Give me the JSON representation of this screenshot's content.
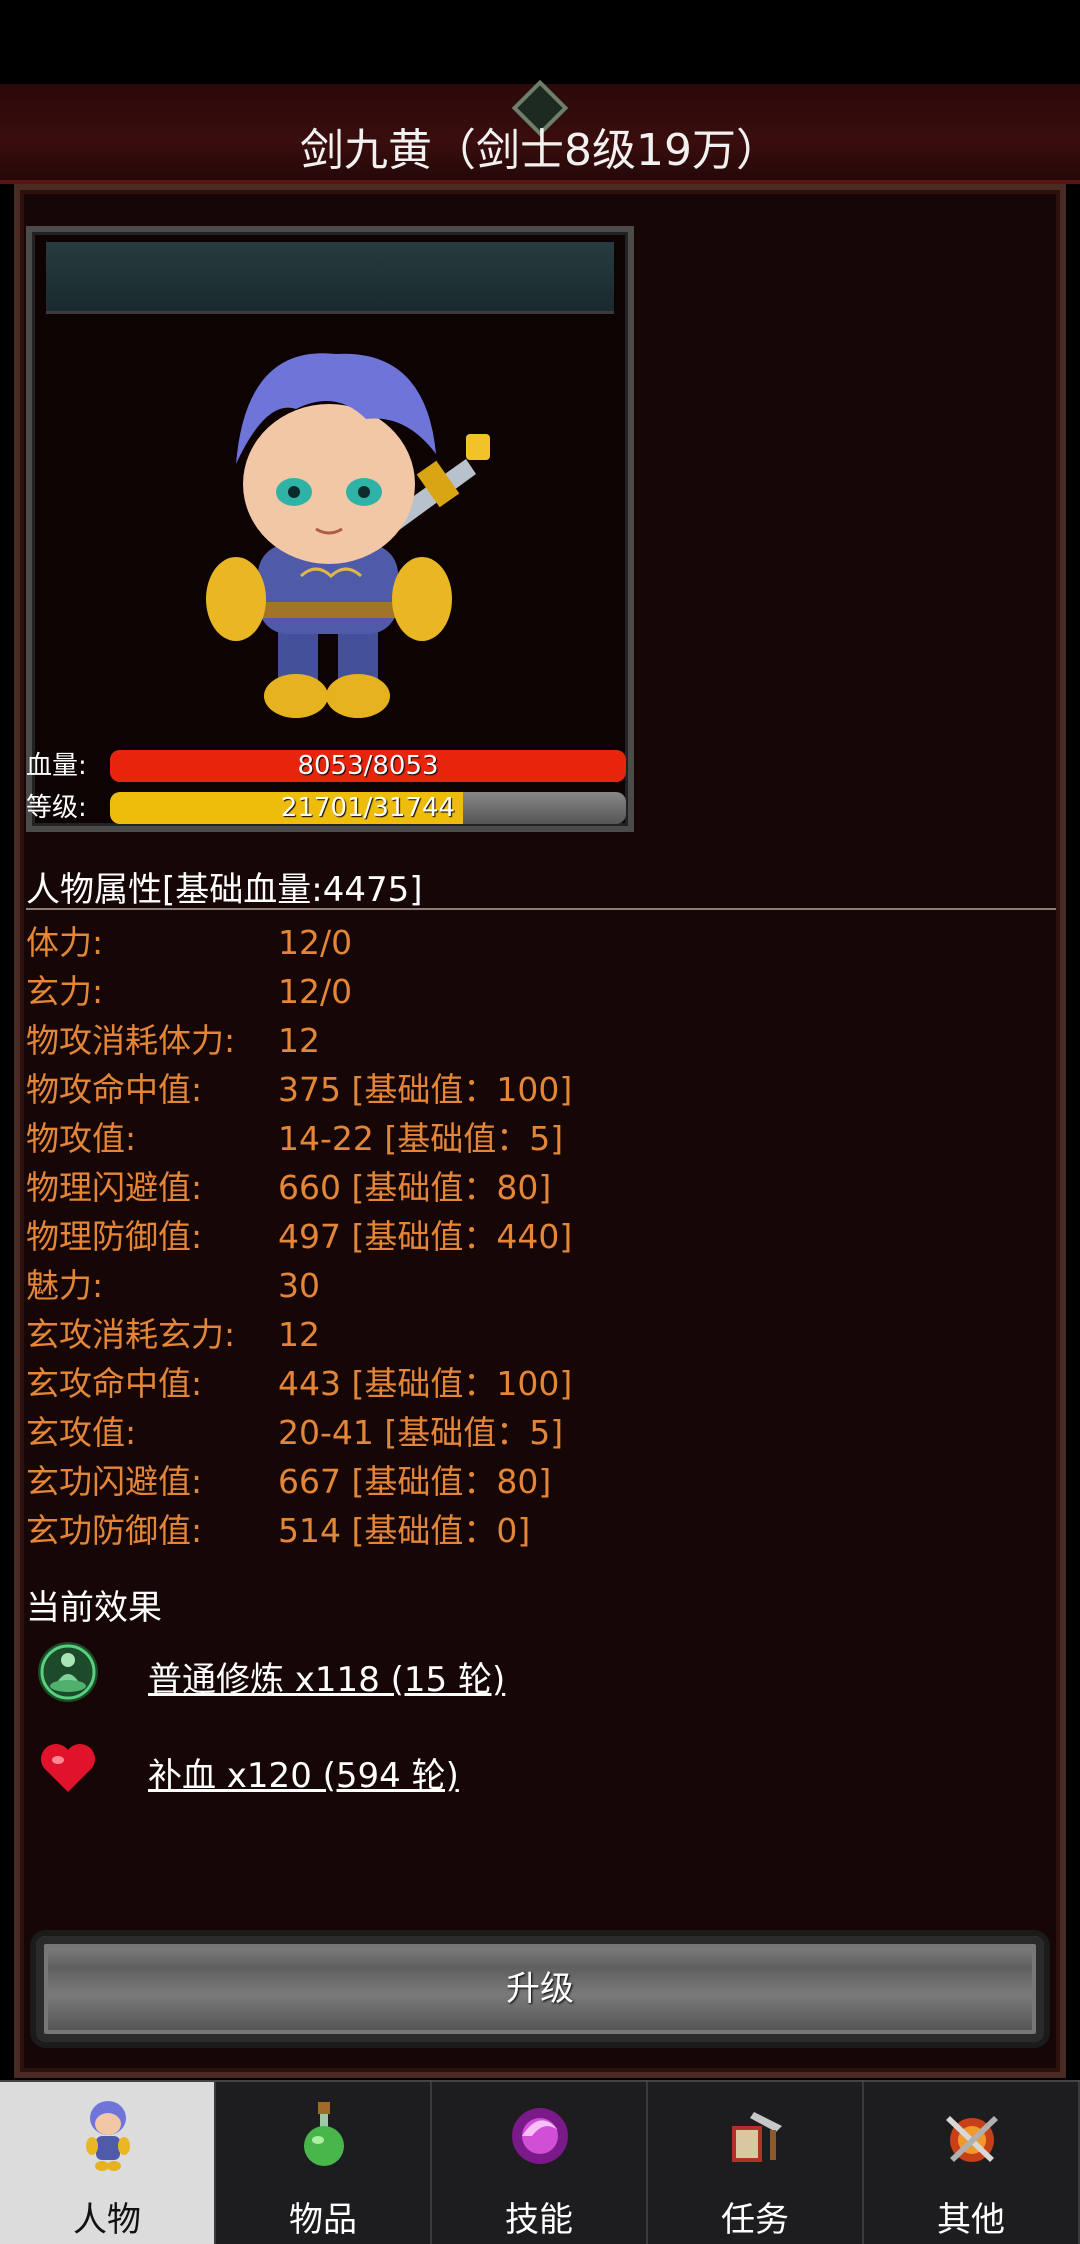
{
  "header": {
    "title": "剑九黄（剑士8级19万）"
  },
  "character": {
    "hp_label": "血量:",
    "hp_text": "8053/8053",
    "hp_fraction": 1.0,
    "level_label": "等级:",
    "level_text": "21701/31744",
    "level_fraction": 0.684
  },
  "attributes": {
    "header": "人物属性[基础血量:4475]",
    "rows": [
      {
        "name": "体力:",
        "value": "12/0"
      },
      {
        "name": "玄力:",
        "value": "12/0"
      },
      {
        "name": "物攻消耗体力:",
        "value": "12"
      },
      {
        "name": "物攻命中值:",
        "value": "375 [基础值：100]"
      },
      {
        "name": "物攻值:",
        "value": "14-22 [基础值：5]"
      },
      {
        "name": "物理闪避值:",
        "value": "660 [基础值：80]"
      },
      {
        "name": "物理防御值:",
        "value": "497 [基础值：440]"
      },
      {
        "name": "魅力:",
        "value": "30"
      },
      {
        "name": "玄攻消耗玄力:",
        "value": "12"
      },
      {
        "name": "玄攻命中值:",
        "value": "443 [基础值：100]"
      },
      {
        "name": "玄攻值:",
        "value": "20-41 [基础值：5]"
      },
      {
        "name": "玄功闪避值:",
        "value": "667 [基础值：80]"
      },
      {
        "name": "玄功防御值:",
        "value": "514 [基础值：0]"
      }
    ]
  },
  "effects": {
    "header": "当前效果",
    "items": [
      {
        "icon": "meditation-icon",
        "text": "普通修炼 x118 (15 轮)"
      },
      {
        "icon": "heart-icon",
        "text": "补血 x120 (594 轮)"
      }
    ]
  },
  "upgrade": {
    "label": "升级"
  },
  "tabs": [
    {
      "label": "人物",
      "icon": "character-icon",
      "active": true
    },
    {
      "label": "物品",
      "icon": "potion-icon",
      "active": false
    },
    {
      "label": "技能",
      "icon": "skill-orb-icon",
      "active": false
    },
    {
      "label": "任务",
      "icon": "quest-icon",
      "active": false
    },
    {
      "label": "其他",
      "icon": "other-icon",
      "active": false
    }
  ],
  "colors": {
    "hp_bar": "#e8240d",
    "level_bar": "#eebd0c",
    "attribute_text": "#e38637",
    "panel_bg": "#170606"
  }
}
